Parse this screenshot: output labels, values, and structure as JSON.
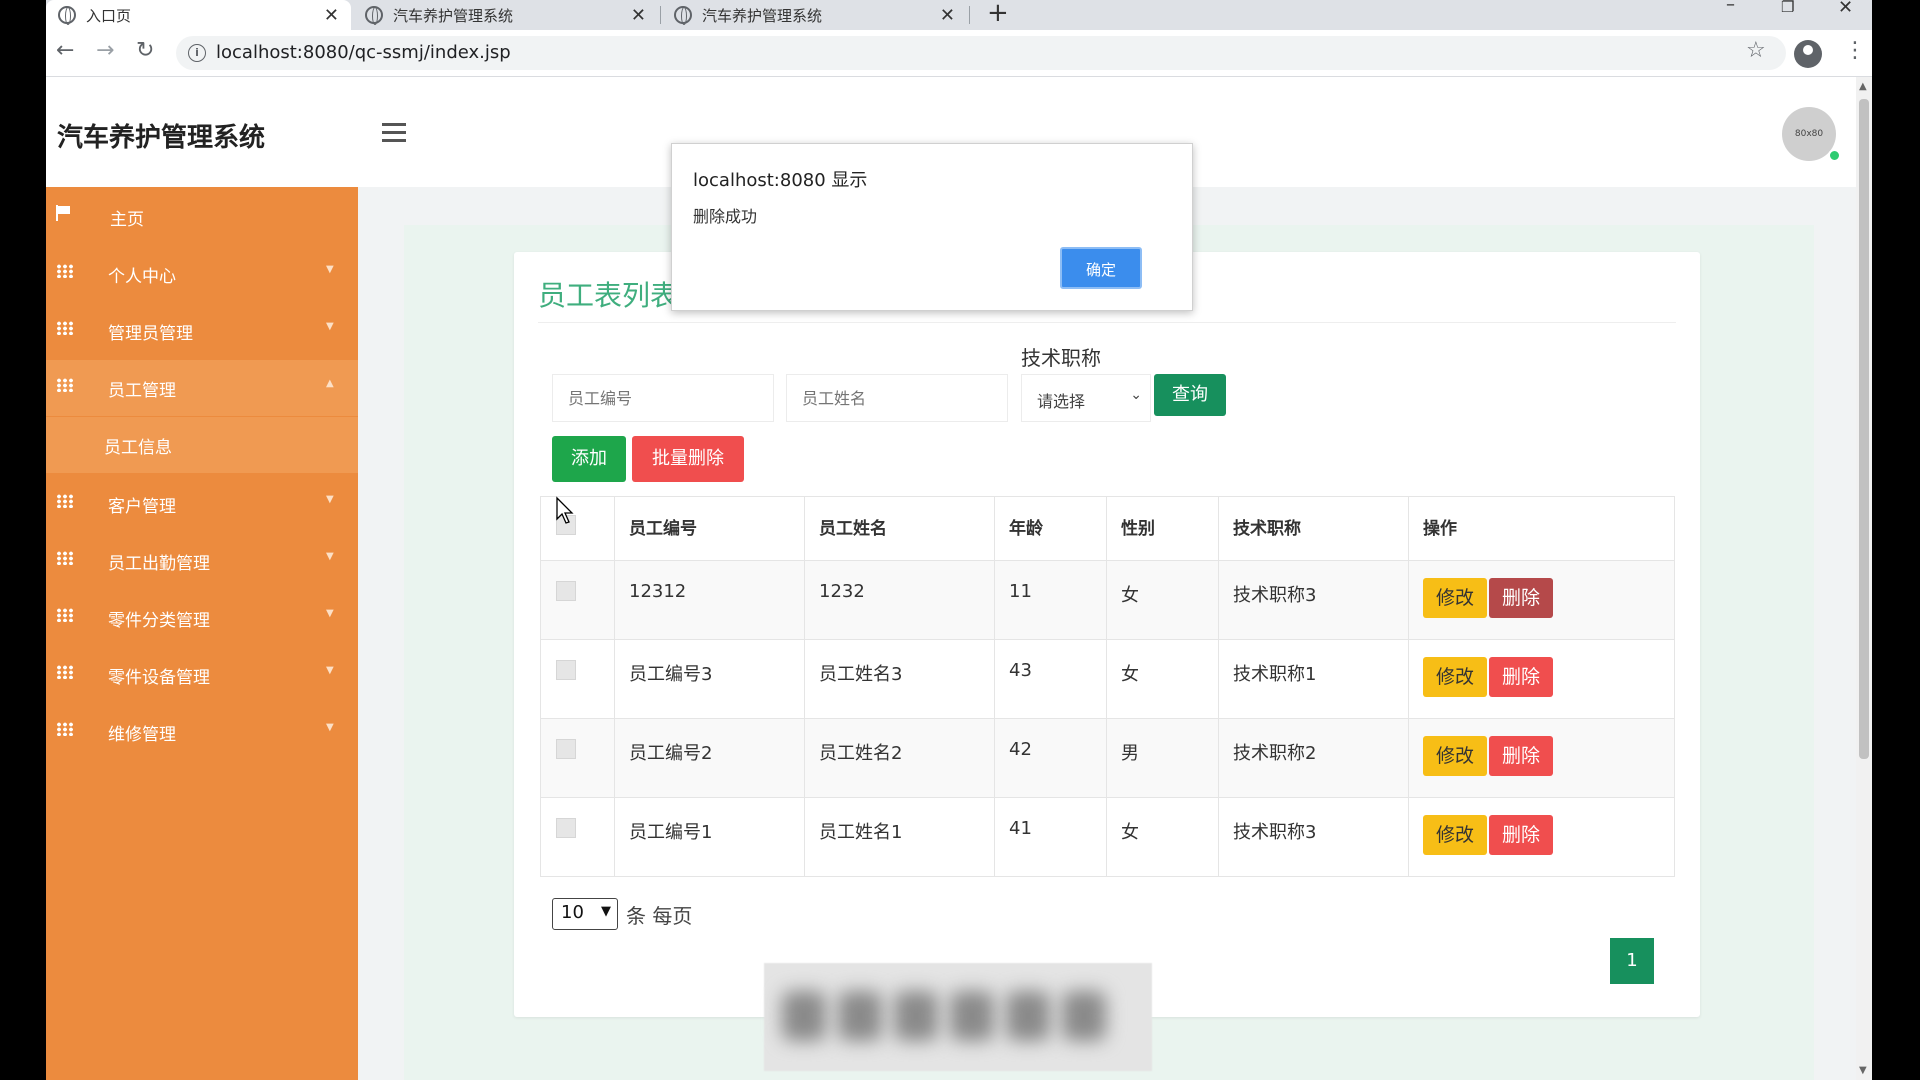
{
  "browser": {
    "tabs": [
      {
        "title": "入口页",
        "active": true
      },
      {
        "title": "汽车养护管理系统",
        "active": false
      },
      {
        "title": "汽车养护管理系统",
        "active": false
      }
    ],
    "url": "localhost:8080/qc-ssmj/index.jsp"
  },
  "app": {
    "title": "汽车养护管理系统",
    "avatar_text": "80x80"
  },
  "sidebar": {
    "items": [
      {
        "label": "主页",
        "icon": "flag-icon"
      },
      {
        "label": "个人中心",
        "icon": "grid-icon"
      },
      {
        "label": "管理员管理",
        "icon": "grid-icon"
      },
      {
        "label": "员工管理",
        "icon": "grid-icon",
        "expanded": true
      },
      {
        "label": "员工信息",
        "sub": true
      },
      {
        "label": "客户管理",
        "icon": "grid-icon"
      },
      {
        "label": "员工出勤管理",
        "icon": "grid-icon"
      },
      {
        "label": "零件分类管理",
        "icon": "grid-icon"
      },
      {
        "label": "零件设备管理",
        "icon": "grid-icon"
      },
      {
        "label": "维修管理",
        "icon": "grid-icon"
      }
    ]
  },
  "page": {
    "title": "员工表列表",
    "filter_label": "技术职称",
    "search": {
      "id_placeholder": "员工编号",
      "name_placeholder": "员工姓名",
      "select_value": "请选择",
      "query_label": "查询"
    },
    "buttons": {
      "add": "添加",
      "batch_delete": "批量删除"
    },
    "table": {
      "headers": [
        "员工编号",
        "员工姓名",
        "年龄",
        "性别",
        "技术职称",
        "操作"
      ],
      "rows": [
        {
          "id": "12312",
          "name": "1232",
          "age": "11",
          "gender": "女",
          "title": "技术职称3"
        },
        {
          "id": "员工编号3",
          "name": "员工姓名3",
          "age": "43",
          "gender": "女",
          "title": "技术职称1"
        },
        {
          "id": "员工编号2",
          "name": "员工姓名2",
          "age": "42",
          "gender": "男",
          "title": "技术职称2"
        },
        {
          "id": "员工编号1",
          "name": "员工姓名1",
          "age": "41",
          "gender": "女",
          "title": "技术职称3"
        }
      ],
      "edit_label": "修改",
      "delete_label": "删除"
    },
    "pagination": {
      "page_size": "10",
      "per_page_label": "条 每页",
      "current_page": "1"
    }
  },
  "alert": {
    "origin": "localhost:8080 显示",
    "message": "删除成功",
    "ok_label": "确定"
  },
  "colors": {
    "sidebar": "#ec8b3e",
    "accent_green": "#17905d",
    "danger": "#f04e4e",
    "warning": "#f7be16"
  }
}
